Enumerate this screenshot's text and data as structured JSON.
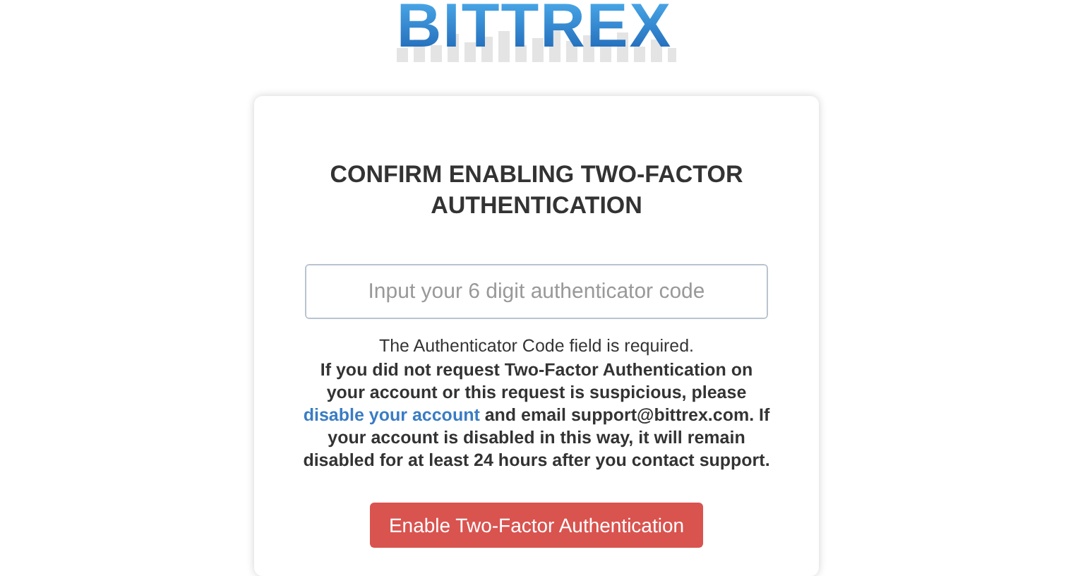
{
  "logo": {
    "text": "BITTREX"
  },
  "card": {
    "title": "CONFIRM ENABLING TWO-FACTOR AUTHENTICATION",
    "code_field": {
      "placeholder": "Input your 6 digit authenticator code"
    },
    "error": "The Authenticator Code field is required.",
    "warning": {
      "before": "If you did not request Two-Factor Authentication on your account or this request is suspicious, please ",
      "link": "disable your account",
      "after": " and email support@bittrex.com. If your account is disabled in this way, it will remain disabled for at least 24 hours after you contact support."
    },
    "submit_button": "Enable Two-Factor Authentication"
  }
}
